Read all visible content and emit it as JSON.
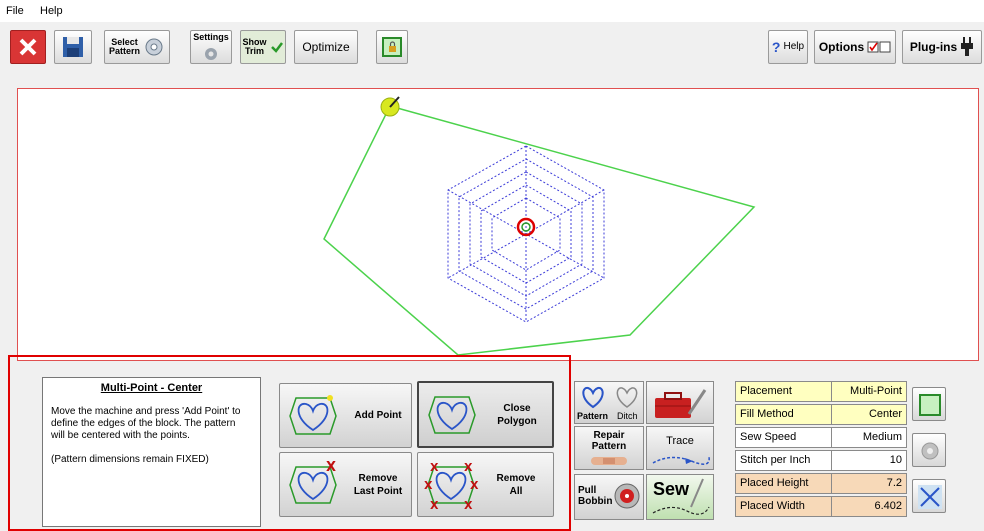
{
  "menu": {
    "file": "File",
    "help": "Help"
  },
  "toolbar": {
    "select_pattern": [
      "Select",
      "Pattern"
    ],
    "settings": "Settings",
    "show_trim": [
      "Show",
      "Trim"
    ],
    "optimize": "Optimize",
    "help": "Help",
    "options": "Options",
    "plugins": "Plug-ins"
  },
  "info": {
    "title": "Multi-Point - Center",
    "text": "Move the machine and press 'Add Point' to define the edges of the block. The pattern will be centered with the points.",
    "note": "(Pattern dimensions remain FIXED)"
  },
  "actions": {
    "add_point": "Add Point",
    "close_polygon": [
      "Close",
      "Polygon"
    ],
    "remove_last": [
      "Remove",
      "Last Point"
    ],
    "remove_all": [
      "Remove",
      "All"
    ]
  },
  "tools": {
    "pattern": "Pattern",
    "ditch": "Ditch",
    "repair": [
      "Repair",
      "Pattern"
    ],
    "trace": "Trace",
    "pull_bobbin": [
      "Pull",
      "Bobbin"
    ],
    "sew": "Sew"
  },
  "properties": [
    {
      "label": "Placement",
      "value": "Multi-Point"
    },
    {
      "label": "Fill Method",
      "value": "Center"
    },
    {
      "label": "Sew Speed",
      "value": "Medium"
    },
    {
      "label": "Stitch per Inch",
      "value": "10"
    },
    {
      "label": "Placed Height",
      "value": "7.2"
    },
    {
      "label": "Placed Width",
      "value": "6.402"
    }
  ],
  "colors": {
    "polygon": "#4cd24c",
    "pattern": "#3c3cd8",
    "highlight_row": "#ffffc0",
    "dimension_row": "#f7d9b8",
    "canvas_border": "#e05050",
    "panel_frame": "#e00000"
  }
}
